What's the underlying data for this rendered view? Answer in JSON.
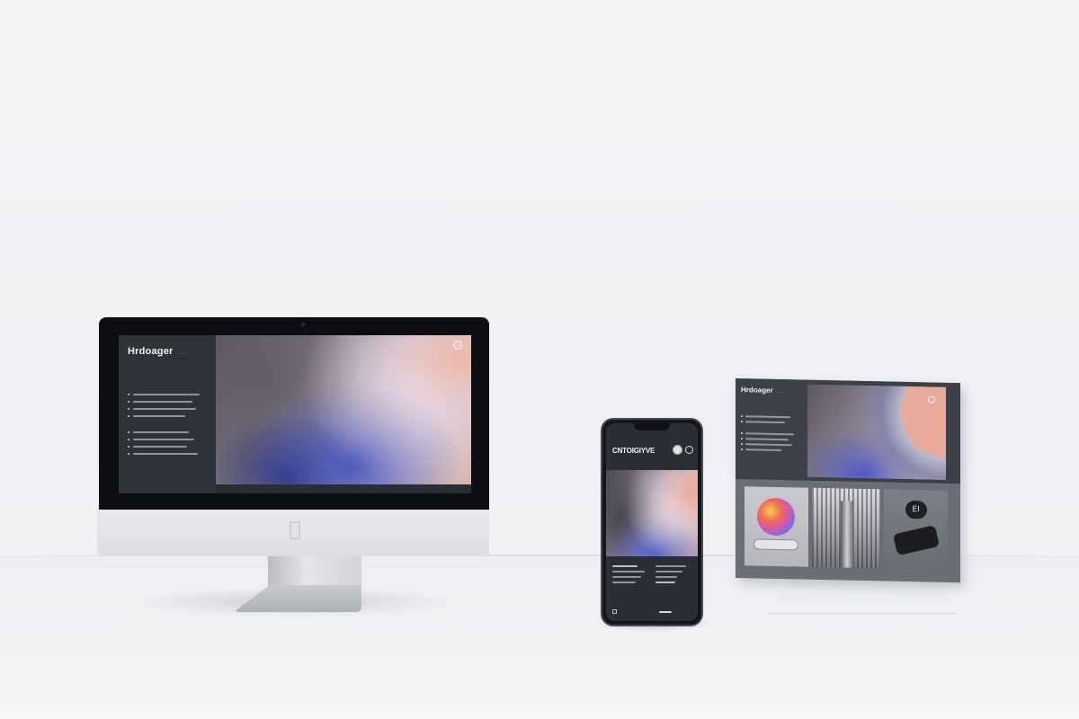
{
  "desktop": {
    "brand": "Hrdoager",
    "subtitle": "— —",
    "menu_button_icon": "circle-icon"
  },
  "phone": {
    "title": "CNTOIGIYVE",
    "bottom_icon": "tab-icon"
  },
  "display_board": {
    "brand": "Hrdoager",
    "subtitle": "— —",
    "tile3_icon_text": "EI"
  },
  "colors": {
    "background": "#f2f3f5",
    "screen_dark": "#2c2e35",
    "accent_blue": "#4856c4",
    "accent_peach": "#e8aa9a"
  }
}
